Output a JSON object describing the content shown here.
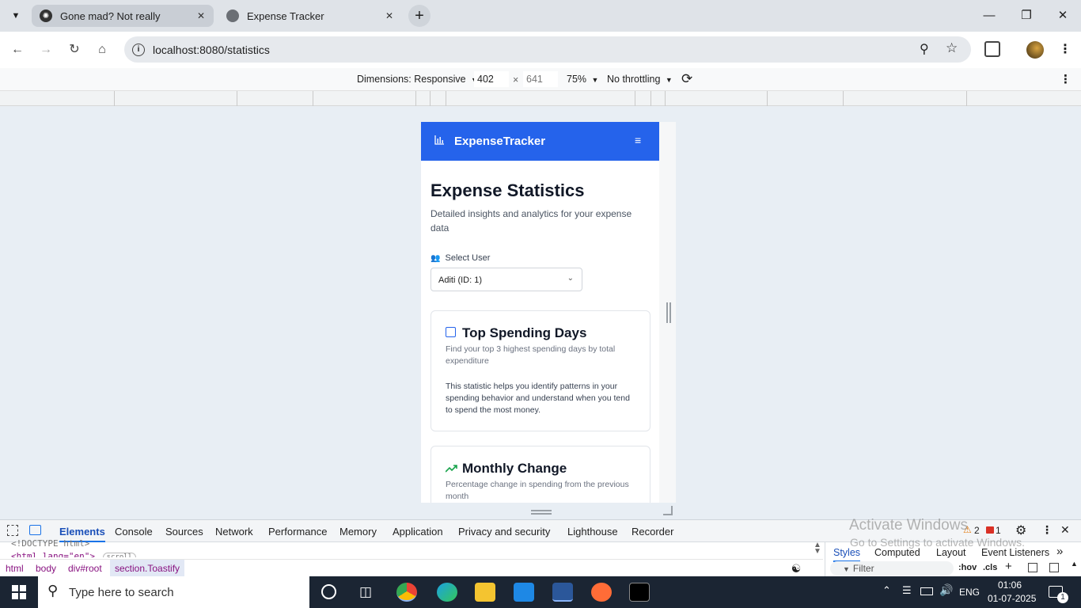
{
  "browser": {
    "tabs": [
      {
        "title": "Gone mad? Not really",
        "active": false
      },
      {
        "title": "Expense Tracker",
        "active": true
      }
    ],
    "url": "localhost:8080/statistics"
  },
  "device_toolbar": {
    "dimensions_label": "Dimensions: Responsive",
    "width": "402",
    "times": "×",
    "height": "641",
    "zoom": "75%",
    "throttling": "No throttling"
  },
  "app": {
    "brand": "ExpenseTracker",
    "page_title": "Expense Statistics",
    "page_subtitle": "Detailed insights and analytics for your expense data",
    "select_user_label": "Select User",
    "select_user_value": "Aditi (ID: 1)",
    "cards": [
      {
        "title": "Top Spending Days",
        "subtitle": "Find your top 3 highest spending days by total expenditure",
        "description": "This statistic helps you identify patterns in your spending behavior and understand when you tend to spend the most money."
      },
      {
        "title": "Monthly Change",
        "subtitle": "Percentage change in spending from the previous month"
      }
    ]
  },
  "devtools": {
    "tabs": [
      "Elements",
      "Console",
      "Sources",
      "Network",
      "Performance",
      "Memory",
      "Application",
      "Privacy and security",
      "Lighthouse",
      "Recorder"
    ],
    "warnings": "2",
    "errors": "1",
    "code_line1": "<!DOCTYPE html>",
    "code_line2": "<html lang=\"en\">",
    "scroll_badge": "scroll",
    "breadcrumbs": [
      "html",
      "body",
      "div#root",
      "section.Toastify"
    ],
    "styles_tabs": [
      "Styles",
      "Computed",
      "Layout",
      "Event Listeners"
    ],
    "filter_placeholder": "Filter",
    "hov": ":hov",
    "cls": ".cls",
    "activate_title": "Activate Windows",
    "activate_sub": "Go to Settings to activate Windows."
  },
  "taskbar": {
    "search_placeholder": "Type here to search",
    "language": "ENG",
    "time": "01:06",
    "date": "01-07-2025",
    "notification_count": "1"
  }
}
